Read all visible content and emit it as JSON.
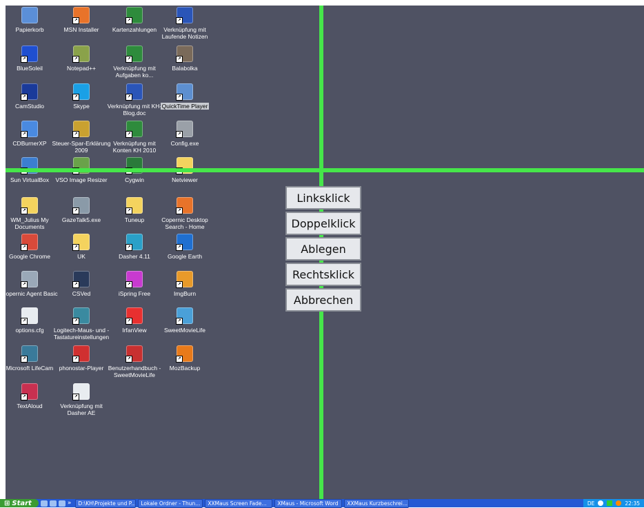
{
  "desktop": {
    "icons": [
      {
        "label": "Papierkorb",
        "icon": "recycle-bin-icon"
      },
      {
        "label": "MSN Installer",
        "icon": "msn-icon"
      },
      {
        "label": "Kartenzahlungen",
        "icon": "excel-doc-icon"
      },
      {
        "label": "Verknüpfung mit Laufende Notizen",
        "icon": "word-doc-icon"
      },
      {
        "label": "BlueSoleil",
        "icon": "bluetooth-icon"
      },
      {
        "label": "Notepad++",
        "icon": "notepad-icon"
      },
      {
        "label": "Verknüpfung mit Aufgaben ko...",
        "icon": "excel-doc-icon"
      },
      {
        "label": "Balabolka",
        "icon": "balabolka-icon"
      },
      {
        "label": "CamStudio",
        "icon": "camstudio-icon"
      },
      {
        "label": "Skype",
        "icon": "skype-icon"
      },
      {
        "label": "Verknüpfung mit KH-Blog.doc",
        "icon": "word-doc-icon"
      },
      {
        "label": "QuickTime Player",
        "icon": "quicktime-icon"
      },
      {
        "label": "CDBurnerXP",
        "icon": "cdburner-icon"
      },
      {
        "label": "Steuer-Spar-Erklärung 2009",
        "icon": "tax-app-icon"
      },
      {
        "label": "Verknüpfung mit Konten KH 2010",
        "icon": "excel-doc-icon"
      },
      {
        "label": "Config.exe",
        "icon": "config-icon"
      },
      {
        "label": "Sun VirtualBox",
        "icon": "virtualbox-icon"
      },
      {
        "label": "VSO Image Resizer",
        "icon": "image-resizer-icon"
      },
      {
        "label": "Cygwin",
        "icon": "cygwin-icon"
      },
      {
        "label": "Netviewer",
        "icon": "folder-icon"
      },
      {
        "label": "WM_Julius My Documents",
        "icon": "my-documents-icon"
      },
      {
        "label": "GazeTalk5.exe",
        "icon": "gazetalk-icon"
      },
      {
        "label": "Tuneup",
        "icon": "folder-icon"
      },
      {
        "label": "Copernic Desktop Search - Home",
        "icon": "copernic-search-icon"
      },
      {
        "label": "Google Chrome",
        "icon": "chrome-icon"
      },
      {
        "label": "UK",
        "icon": "folder-icon"
      },
      {
        "label": "Dasher 4.11",
        "icon": "dasher-icon"
      },
      {
        "label": "Google Earth",
        "icon": "google-earth-icon"
      },
      {
        "label": "Copernic Agent Basic",
        "icon": "copernic-agent-icon"
      },
      {
        "label": "CSVed",
        "icon": "csved-icon"
      },
      {
        "label": "iSpring Free",
        "icon": "ispring-icon"
      },
      {
        "label": "ImgBurn",
        "icon": "imgburn-icon"
      },
      {
        "label": "options.cfg",
        "icon": "cfg-file-icon"
      },
      {
        "label": "Logitech-Maus- und -Tastatureinstellungen",
        "icon": "logitech-icon"
      },
      {
        "label": "IrfanView",
        "icon": "irfanview-icon"
      },
      {
        "label": "SweetMovieLife",
        "icon": "sweetmovielife-icon"
      },
      {
        "label": "Microsoft LifeCam",
        "icon": "lifecam-icon"
      },
      {
        "label": "phonostar-Player",
        "icon": "phonostar-icon"
      },
      {
        "label": "Benutzerhandbuch - SweetMovieLife",
        "icon": "pdf-icon"
      },
      {
        "label": "MozBackup",
        "icon": "mozbackup-icon"
      },
      {
        "label": "TextAloud",
        "icon": "textaloud-icon"
      },
      {
        "label": "Verknüpfung mit Dasher AE",
        "icon": "window-icon"
      }
    ]
  },
  "click_menu": {
    "left_click": "Linksklick",
    "double_click": "Doppelklick",
    "drop": "Ablegen",
    "right_click": "Rechtsklick",
    "cancel": "Abbrechen"
  },
  "taskbar": {
    "start": "Start",
    "overflow": "»",
    "tasks": [
      "D:\\KH\\Projekte und P...",
      "Lokale Ordner - Thun...",
      "XXMaus Screen Fade...",
      "XMaus - Microsoft Word",
      "XXMaus Kurzbeschrei..."
    ],
    "language": "DE",
    "clock": "22:35"
  },
  "colors": {
    "desktop": "#4f5263",
    "crosshair": "#46e64a",
    "taskbar": "#2459d4",
    "start": "#3b9c32"
  }
}
